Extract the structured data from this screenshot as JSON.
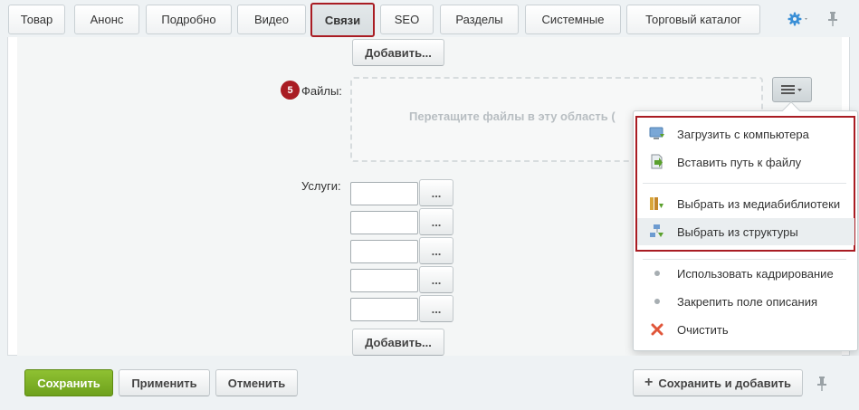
{
  "tabs": [
    {
      "label": "Товар"
    },
    {
      "label": "Анонс"
    },
    {
      "label": "Подробно"
    },
    {
      "label": "Видео"
    },
    {
      "label": "Связи",
      "active": true
    },
    {
      "label": "SEO"
    },
    {
      "label": "Разделы"
    },
    {
      "label": "Системные"
    },
    {
      "label": "Торговый каталог"
    }
  ],
  "top_add_button": "Добавить...",
  "files": {
    "badge": "5",
    "label": "Файлы:",
    "dropzone_text": "Перетащите файлы в эту область ("
  },
  "services": {
    "label": "Услуги:",
    "rows": [
      {
        "value": "",
        "browse": "..."
      },
      {
        "value": "",
        "browse": "..."
      },
      {
        "value": "",
        "browse": "..."
      },
      {
        "value": "",
        "browse": "..."
      },
      {
        "value": "",
        "browse": "..."
      }
    ],
    "add_button": "Добавить..."
  },
  "menu": {
    "items": [
      {
        "label": "Загрузить с компьютера",
        "icon": "computer-upload-icon"
      },
      {
        "label": "Вставить путь к файлу",
        "icon": "file-path-icon"
      },
      {
        "label": "Выбрать из медиабиблиотеки",
        "icon": "media-library-icon"
      },
      {
        "label": "Выбрать из структуры",
        "icon": "site-structure-icon"
      },
      {
        "label": "Использовать кадрирование",
        "icon": "bullet-icon"
      },
      {
        "label": "Закрепить поле описания",
        "icon": "bullet-icon"
      },
      {
        "label": "Очистить",
        "icon": "clear-icon"
      }
    ]
  },
  "footer": {
    "save": "Сохранить",
    "apply": "Применить",
    "cancel": "Отменить",
    "save_and_add": "Сохранить и добавить"
  },
  "colors": {
    "accent_red": "#a91c23",
    "save_green": "#7ab225",
    "clear_red": "#d9534f"
  }
}
